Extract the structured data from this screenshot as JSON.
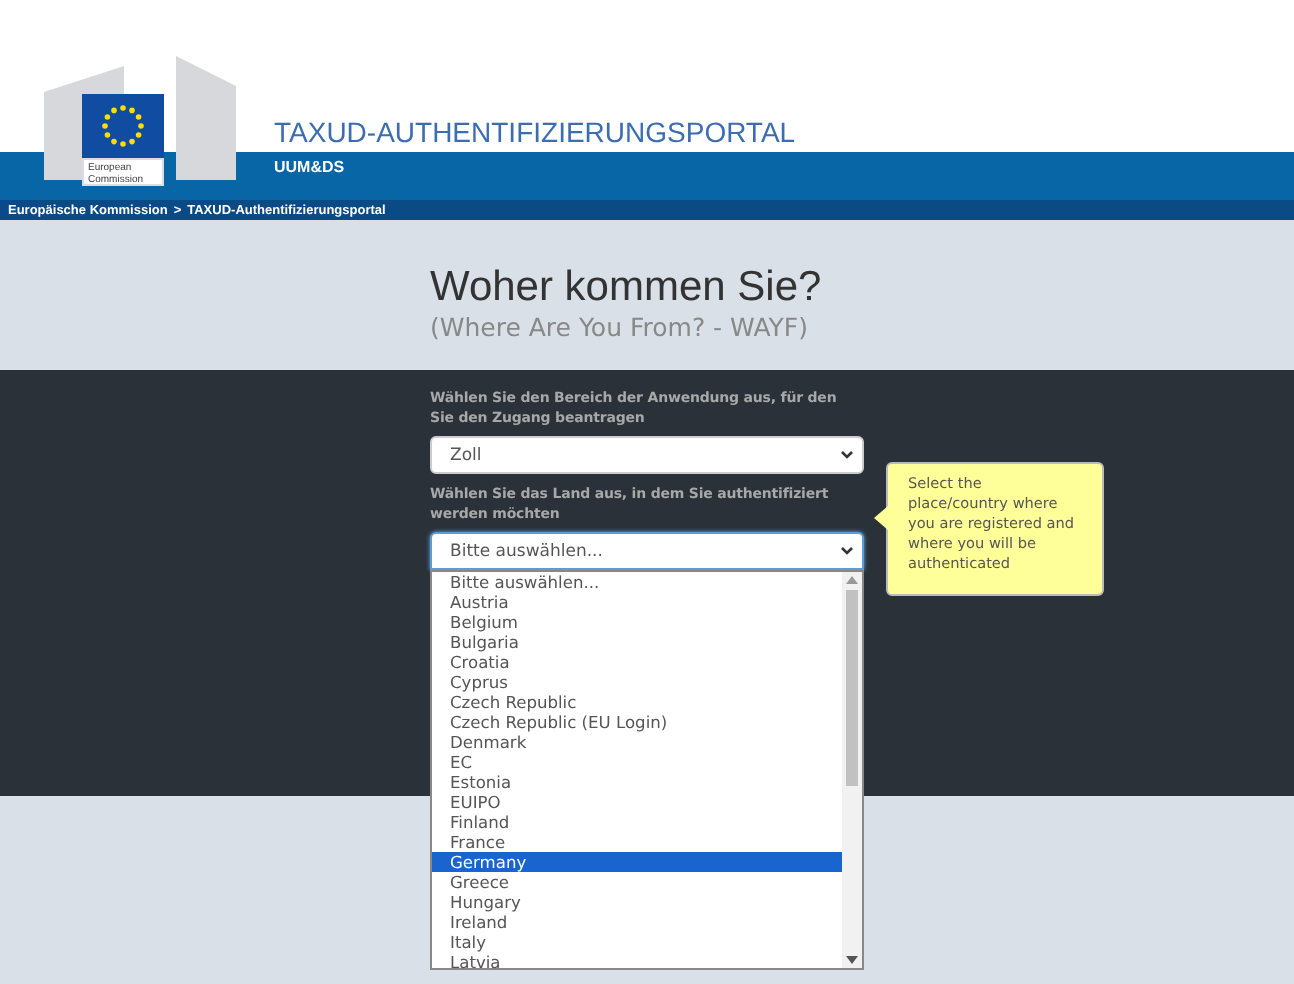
{
  "header": {
    "logo_text": "European Commission",
    "title": "TAXUD-AUTHENTIFIZIERUNGSPORTAL",
    "subtitle": "UUM&DS"
  },
  "breadcrumb": {
    "items": [
      "Europäische Kommission",
      "TAXUD-Authentifizierungsportal"
    ],
    "separator": ">"
  },
  "heading": {
    "title": "Woher kommen Sie?",
    "subtitle": "(Where Are You From? - WAYF)"
  },
  "fields": [
    {
      "label": "Wählen Sie den Bereich der Anwendung aus, für den Sie den Zugang beantragen",
      "value": "Zoll",
      "focused": false,
      "expanded": false
    },
    {
      "label": "Wählen Sie das Land aus, in dem Sie authentifiziert werden möchten",
      "value": "Bitte auswählen...",
      "focused": true,
      "expanded": true
    }
  ],
  "tooltip": "Select the place/country where you are registered and where you will be authenticated",
  "options": [
    {
      "label": "Bitte auswählen...",
      "selected": false
    },
    {
      "label": "Austria",
      "selected": false
    },
    {
      "label": "Belgium",
      "selected": false
    },
    {
      "label": "Bulgaria",
      "selected": false
    },
    {
      "label": "Croatia",
      "selected": false
    },
    {
      "label": "Cyprus",
      "selected": false
    },
    {
      "label": "Czech Republic",
      "selected": false
    },
    {
      "label": "Czech Republic (EU Login)",
      "selected": false
    },
    {
      "label": "Denmark",
      "selected": false
    },
    {
      "label": "EC",
      "selected": false
    },
    {
      "label": "Estonia",
      "selected": false
    },
    {
      "label": "EUIPO",
      "selected": false
    },
    {
      "label": "Finland",
      "selected": false
    },
    {
      "label": "France",
      "selected": false
    },
    {
      "label": "Germany",
      "selected": true
    },
    {
      "label": "Greece",
      "selected": false
    },
    {
      "label": "Hungary",
      "selected": false
    },
    {
      "label": "Ireland",
      "selected": false
    },
    {
      "label": "Italy",
      "selected": false
    },
    {
      "label": "Latvia",
      "selected": false
    }
  ]
}
